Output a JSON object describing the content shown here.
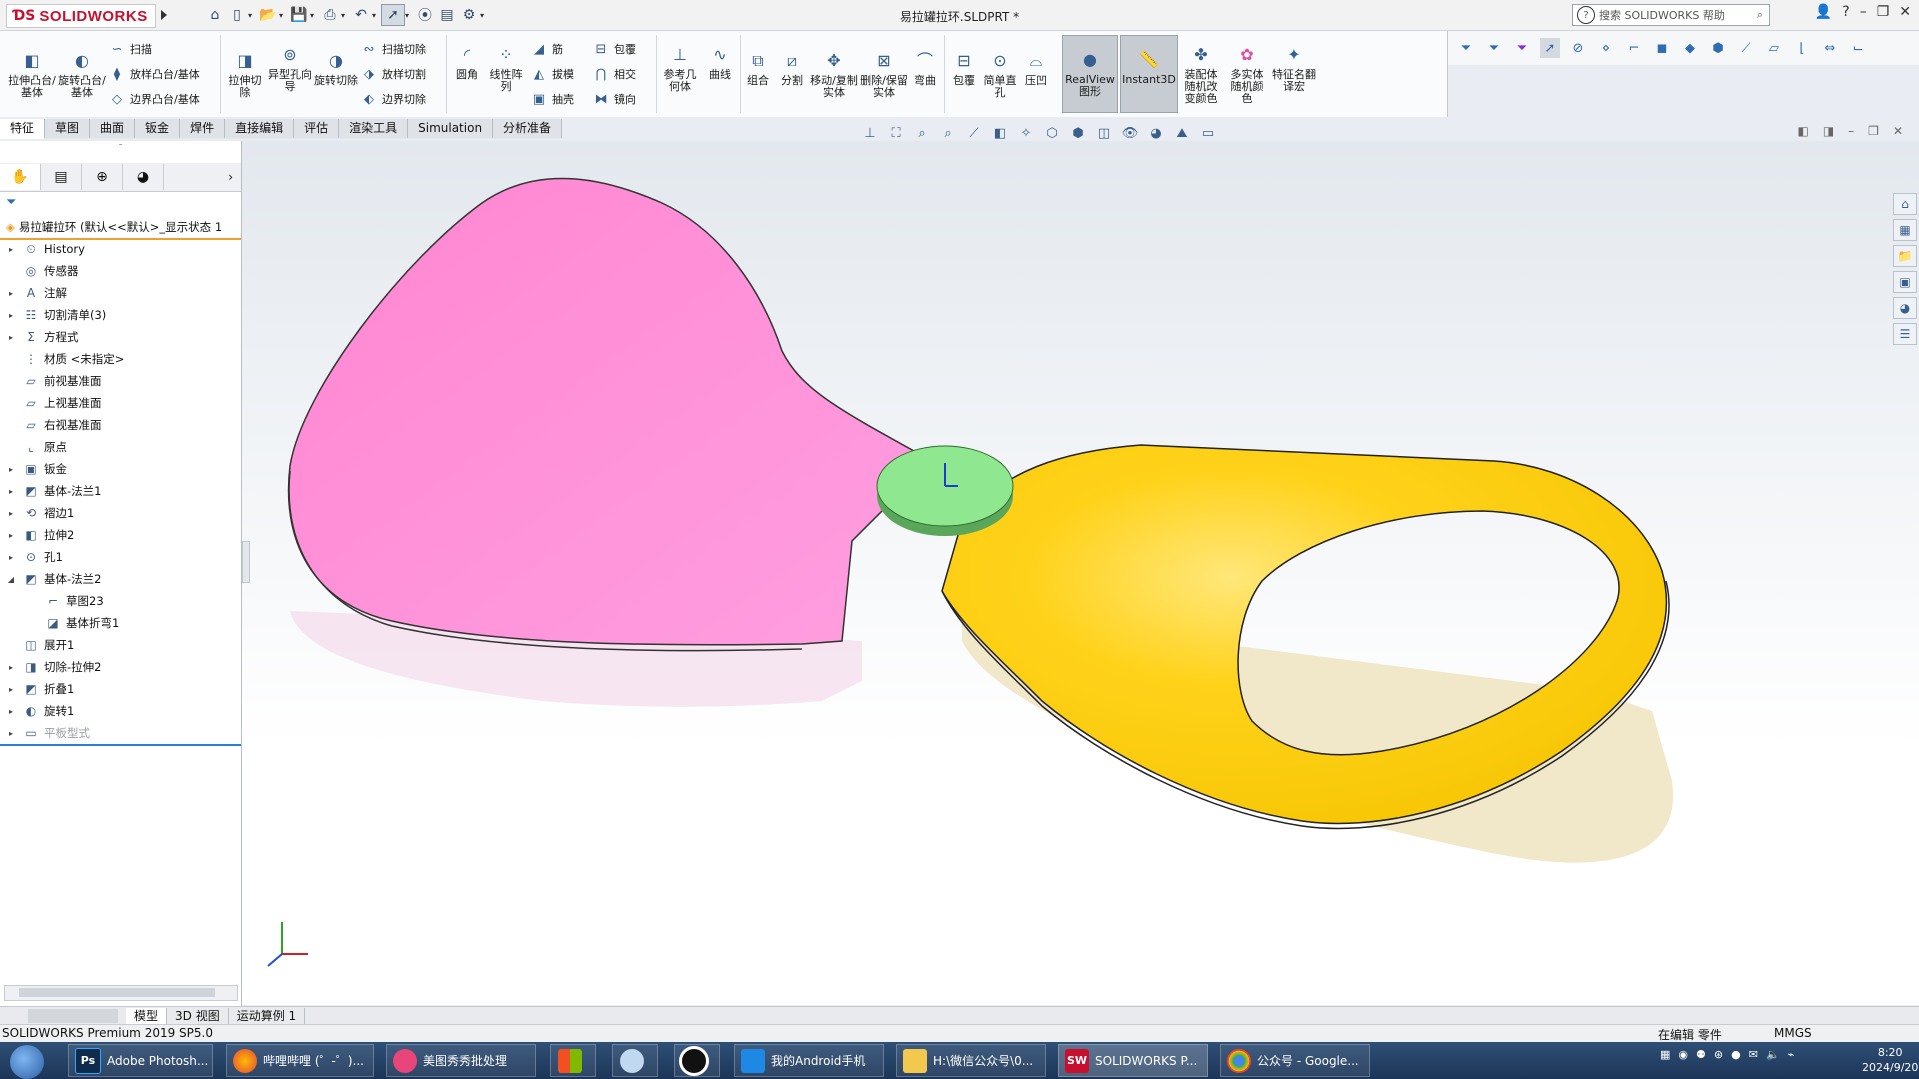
{
  "app": {
    "logo_text": "SOLIDWORKS",
    "document_title": "易拉罐拉环.SLDPRT *",
    "help_search_placeholder": "搜索 SOLIDWORKS 帮助",
    "accent_color": "#c8102e"
  },
  "ribbon": {
    "extrude_boss": "拉伸凸台/基体",
    "revolve_boss": "旋转凸台/基体",
    "sweep": "扫描",
    "loft_boss": "放样凸台/基体",
    "boundary_boss": "边界凸台/基体",
    "extrude_cut": "拉伸切除",
    "hole_wizard": "异型孔向导",
    "revolve_cut": "旋转切除",
    "sweep_cut": "扫描切除",
    "loft_cut": "放样切割",
    "boundary_cut": "边界切除",
    "fillet": "圆角",
    "linear_pattern": "线性阵列",
    "rib": "筋",
    "draft": "拔模",
    "shell": "抽壳",
    "wrap": "包覆",
    "intersect": "相交",
    "mirror": "镜向",
    "ref_geometry": "参考几何体",
    "curves": "曲线",
    "combine": "组合",
    "split": "分割",
    "move_copy": "移动/复制实体",
    "delete_keep": "删除/保留实体",
    "flex": "弯曲",
    "wrap2": "包覆",
    "simple_hole": "简单直孔",
    "indent": "压凹",
    "realview": "RealView 图形",
    "instant3d": "Instant3D",
    "assembly_random_color": "装配体随机改变颜色",
    "multibody_random_color": "多实体随机颜色",
    "feature_translate": "特征名翻译宏"
  },
  "command_tabs": [
    "特征",
    "草图",
    "曲面",
    "钣金",
    "焊件",
    "直接编辑",
    "评估",
    "渲染工具",
    "Simulation",
    "分析准备"
  ],
  "feature_tree": {
    "root": "易拉罐拉环 (默认<<默认>_显示状态 1",
    "items": [
      {
        "label": "History",
        "icon": "history-icon"
      },
      {
        "label": "传感器",
        "icon": "sensor-icon"
      },
      {
        "label": "注解",
        "icon": "annotation-icon"
      },
      {
        "label": "切割清单(3)",
        "icon": "cutlist-icon"
      },
      {
        "label": "方程式",
        "icon": "equation-icon"
      },
      {
        "label": "材质 <未指定>",
        "icon": "material-icon"
      },
      {
        "label": "前视基准面",
        "icon": "plane-icon"
      },
      {
        "label": "上视基准面",
        "icon": "plane-icon"
      },
      {
        "label": "右视基准面",
        "icon": "plane-icon"
      },
      {
        "label": "原点",
        "icon": "origin-icon"
      },
      {
        "label": "钣金",
        "icon": "sheetmetal-icon"
      },
      {
        "label": "基体-法兰1",
        "icon": "base-flange-icon"
      },
      {
        "label": "褶边1",
        "icon": "hem-icon"
      },
      {
        "label": "拉伸2",
        "icon": "extrude-icon"
      },
      {
        "label": "孔1",
        "icon": "hole-icon"
      },
      {
        "label": "基体-法兰2",
        "icon": "base-flange-icon"
      },
      {
        "label": "草图23",
        "icon": "sketch-icon"
      },
      {
        "label": "基体折弯1",
        "icon": "base-bend-icon"
      },
      {
        "label": "展开1",
        "icon": "unfold-icon"
      },
      {
        "label": "切除-拉伸2",
        "icon": "cut-extrude-icon"
      },
      {
        "label": "折叠1",
        "icon": "fold-icon"
      },
      {
        "label": "旋转1",
        "icon": "revolve-icon"
      },
      {
        "label": "平板型式",
        "icon": "flat-pattern-icon"
      }
    ]
  },
  "bottom_tabs": [
    "模型",
    "3D 视图",
    "运动算例 1"
  ],
  "status": {
    "product": "SOLIDWORKS Premium 2019 SP5.0",
    "mode": "在编辑 零件",
    "units": "MMGS"
  },
  "taskbar": {
    "items": [
      "Adobe Photosh...",
      "哔哩哔哩 (゜-゜)...",
      "美图秀秀批处理",
      "我的Android手机",
      "H:\\微信公众号\\0...",
      "SOLIDWORKS P...",
      "公众号 - Google..."
    ],
    "time": "8:20",
    "date": "2024/9/20"
  },
  "model_colors": {
    "tab_pink": "#ff8fd6",
    "ring_yellow": "#ffd21a",
    "rivet_green": "#8fe88f"
  }
}
